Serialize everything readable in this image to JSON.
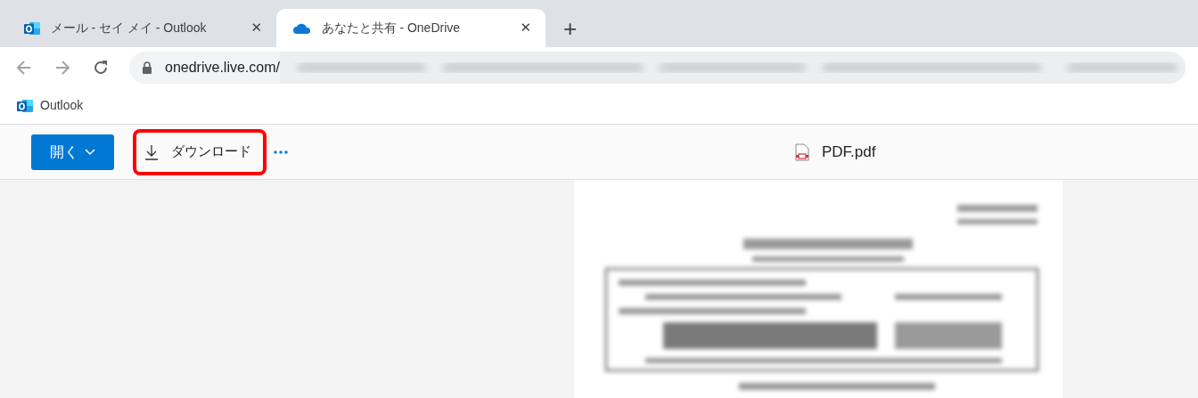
{
  "tabs": [
    {
      "kind": "outlook",
      "title": "メール - セイ メイ - Outlook",
      "selected": false,
      "close": "✕"
    },
    {
      "kind": "onedrive",
      "title": "あなたと共有 - OneDrive",
      "selected": true,
      "close": "✕"
    }
  ],
  "new_tab": "+",
  "address_bar": {
    "url": "onedrive.live.com/",
    "blurred": true
  },
  "bookmarks": [
    {
      "kind": "outlook",
      "label": "Outlook"
    }
  ],
  "toolbar": {
    "open_button": "開く",
    "download_button": "ダウンロード",
    "download_highlighted": true,
    "file_name": "PDF.pdf"
  }
}
